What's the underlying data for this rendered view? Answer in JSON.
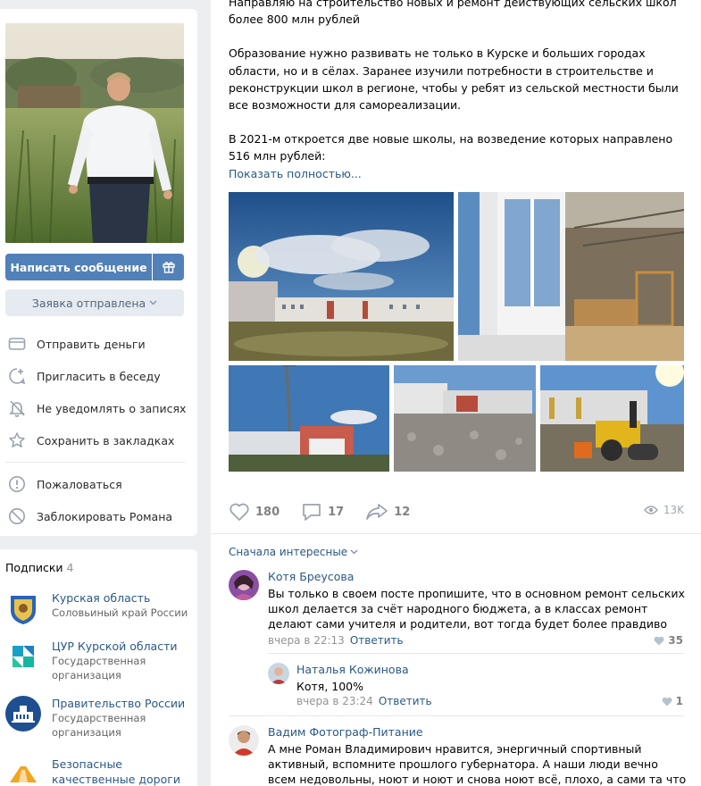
{
  "profile": {
    "write_message": "Написать сообщение",
    "request_sent": "Заявка отправлена",
    "menu": [
      {
        "label": "Отправить деньги",
        "icon": "money-icon"
      },
      {
        "label": "Пригласить в беседу",
        "icon": "invite-chat-icon"
      },
      {
        "label": "Не уведомлять о записях",
        "icon": "bell-off-icon"
      },
      {
        "label": "Сохранить в закладках",
        "icon": "star-icon"
      }
    ],
    "menu2": [
      {
        "label": "Пожаловаться",
        "icon": "report-icon"
      },
      {
        "label": "Заблокировать Романа",
        "icon": "block-icon"
      }
    ]
  },
  "subscriptions": {
    "title": "Подписки",
    "count": "4",
    "items": [
      {
        "name": "Курская область",
        "desc": "Соловьиный край России"
      },
      {
        "name": "ЦУР Курской области",
        "desc": "Государственная организация"
      },
      {
        "name": "Правительство России",
        "desc": "Государственная организация"
      },
      {
        "name": "Безопасные качественные дороги",
        "desc": ""
      }
    ]
  },
  "post": {
    "paragraphs": [
      "Направляю на строительство новых и ремонт действующих сельских школ более 800 млн рублей",
      "Образование нужно развивать не только в Курске и больших городах области, но и в сёлах. Заранее изучили потребности в строительстве и реконструкции школ в регионе, чтобы у ребят из сельской местности были все  возможности для самореализации.",
      "В 2021-м откроется две новые школы, на возведение которых направлено 516 млн рублей:"
    ],
    "show_more": "Показать полностью...",
    "likes": "180",
    "comments": "17",
    "shares": "12",
    "views": "13K"
  },
  "comments": {
    "sort_label": "Сначала интересные",
    "list": [
      {
        "author": "Котя Бреусова",
        "text": "Вы только в своем посте пропишите, что в основном ремонт сельских школ делается за счёт народного бюджета, а в классах ремонт делают сами учителя и родители, вот тогда будет более правдиво",
        "time": "вчера в 22:13",
        "reply": "Ответить",
        "likes": "35"
      },
      {
        "author": "Наталья Кожинова",
        "text": "Котя, 100%",
        "time": "вчера в 23:24",
        "reply": "Ответить",
        "likes": "1"
      },
      {
        "author": "Вадим Фотограф-Питание",
        "text": "А мне Роман Владимирович нравится, энергичный спортивный активный, вспомните прошлого губернатора. А наши люди вечно всем недовольны, ноют и ноют и снова ноют всё, плохо, а сами та что сделали хорошего,",
        "time": "",
        "reply": "",
        "likes": ""
      }
    ]
  }
}
